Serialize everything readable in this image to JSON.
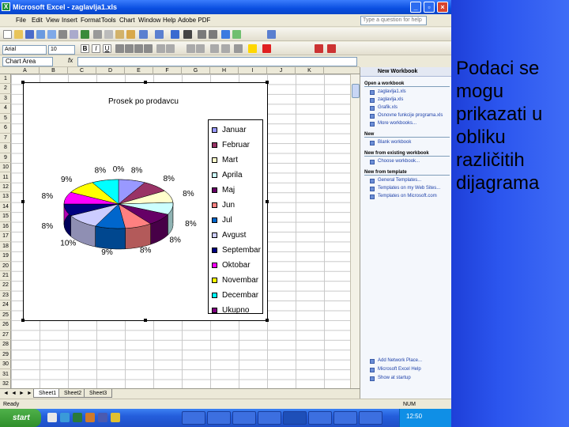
{
  "window": {
    "title": "Microsoft Excel - zaglavlja1.xls",
    "minimize": "_",
    "restore": "▫",
    "close": "×"
  },
  "menu": [
    "File",
    "Edit",
    "View",
    "Insert",
    "Format",
    "Tools",
    "Chart",
    "Window",
    "Help",
    "Adobe PDF"
  ],
  "ask_placeholder": "Type a question for help",
  "font_box": "Arial",
  "size_box": "10",
  "name_box": "Chart Area",
  "fx": "fx",
  "columns": [
    "A",
    "B",
    "C",
    "D",
    "E",
    "F",
    "G",
    "H",
    "I",
    "J",
    "K"
  ],
  "rows": [
    "1",
    "2",
    "3",
    "4",
    "5",
    "6",
    "7",
    "8",
    "9",
    "10",
    "11",
    "12",
    "13",
    "14",
    "15",
    "16",
    "17",
    "18",
    "19",
    "20",
    "21",
    "22",
    "23",
    "24",
    "25",
    "26",
    "27",
    "28",
    "29",
    "30",
    "31",
    "32"
  ],
  "sheet_tabs": [
    "Sheet1",
    "Sheet2",
    "Sheet3"
  ],
  "status": "Ready",
  "status_num": "NUM",
  "task_pane": {
    "title": "New Workbook",
    "sections": [
      {
        "heading": "Open a workbook",
        "items": [
          "zaglavlja1.xls",
          "zaglavlja.xls",
          "Grafik.xls",
          "Osnovne funkcije programa.xls",
          "More workbooks..."
        ]
      },
      {
        "heading": "New",
        "items": [
          "Blank workbook"
        ]
      },
      {
        "heading": "New from existing workbook",
        "items": [
          "Choose workbook..."
        ]
      },
      {
        "heading": "New from template",
        "items": [
          "General Templates...",
          "Templates on my Web Sites...",
          "Templates on Microsoft.com"
        ]
      }
    ],
    "bottom_items": [
      "Add Network Place...",
      "Microsoft Excel Help",
      "Show at startup"
    ]
  },
  "taskbar": {
    "start": "start",
    "clock": "12:50"
  },
  "slide_text": "Podaci se mogu prikazati u obliku različitih dijagrama",
  "chart_data": {
    "type": "pie",
    "title": "Prosek po prodavcu",
    "categories": [
      "Januar",
      "Februar",
      "Mart",
      "Aprila",
      "Maj",
      "Jun",
      "Jul",
      "Avgust",
      "Septembar",
      "Oktobar",
      "Novembar",
      "Decembar",
      "Ukupno"
    ],
    "percent_labels": [
      "8%",
      "8%",
      "8%",
      "8%",
      "8%",
      "8%",
      "9%",
      "10%",
      "8%",
      "8%",
      "9%",
      "8%",
      "0%"
    ],
    "values": [
      8,
      8,
      8,
      8,
      8,
      8,
      9,
      10,
      8,
      8,
      9,
      8,
      0
    ],
    "colors": [
      "#9999ff",
      "#993366",
      "#ffffcc",
      "#ccffff",
      "#660066",
      "#ff8080",
      "#0066cc",
      "#ccccff",
      "#000080",
      "#ff00ff",
      "#ffff00",
      "#00ffff",
      "#800080"
    ],
    "legend_position": "right",
    "style": "3-D exploded"
  }
}
